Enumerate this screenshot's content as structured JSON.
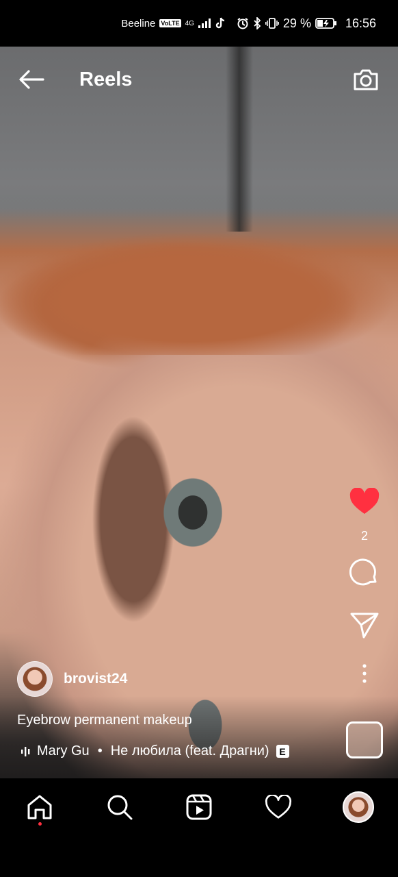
{
  "status_bar": {
    "carrier": "Beeline",
    "volte": "VoLTE",
    "network": "4G",
    "battery_percent": "29 %",
    "time": "16:56"
  },
  "header": {
    "title": "Reels",
    "back_icon": "arrow-left-icon",
    "camera_icon": "camera-icon"
  },
  "actions": {
    "like_icon": "heart-filled-icon",
    "like_color": "#ff3040",
    "like_count": "2",
    "comment_icon": "comment-icon",
    "share_icon": "send-icon",
    "more_icon": "more-vertical-icon"
  },
  "post": {
    "author": "brovist24",
    "caption": "Eyebrow permanent makeup",
    "audio_artist": "Mary Gu",
    "audio_separator": "•",
    "audio_title": "Не любила (feat. Драгни)",
    "explicit_badge": "E"
  },
  "bottom_nav": {
    "items": [
      "home-icon",
      "search-icon",
      "reels-icon",
      "heart-outline-icon",
      "profile-avatar"
    ],
    "active": "home-icon",
    "notification_dot_color": "#ff3040"
  }
}
